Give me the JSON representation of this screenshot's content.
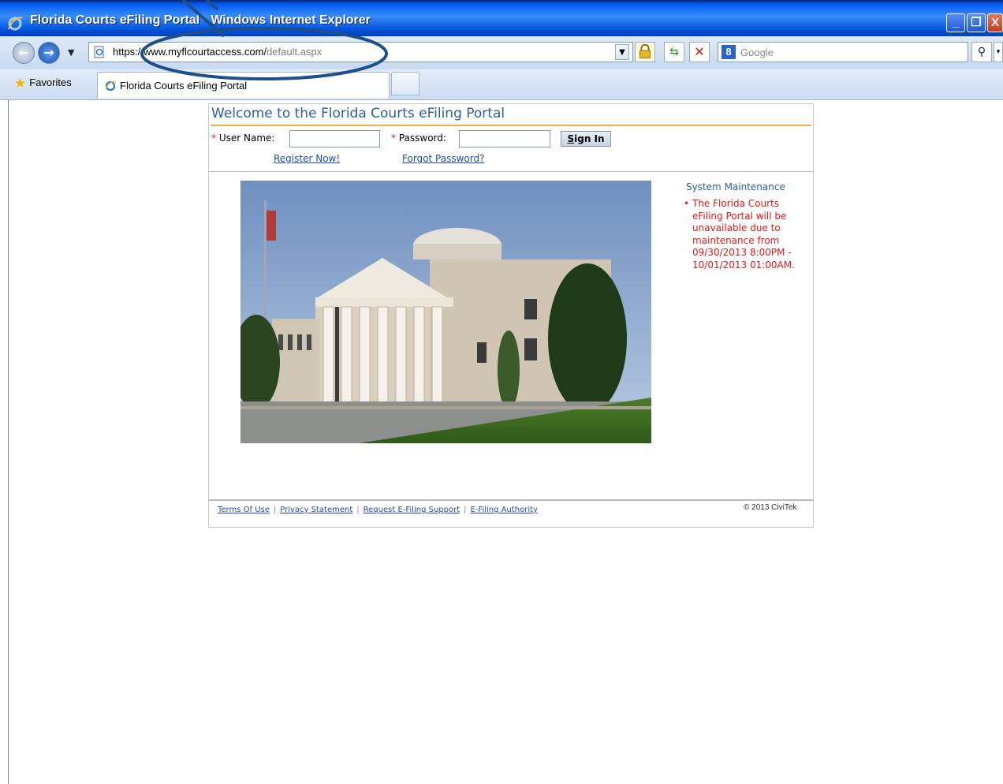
{
  "window": {
    "title": "Florida Courts eFiling Portal - Windows Internet Explorer",
    "controls": {
      "minimize": "_",
      "maximize": "❐",
      "close": "X"
    }
  },
  "toolbar": {
    "url_host": "https://www.myflcourtaccess.com/",
    "url_path": "default.aspx",
    "search_provider": "Google",
    "search_icon_letter": "8",
    "favorites_label": "Favorites"
  },
  "tabs": [
    {
      "label": "Florida Courts eFiling Portal",
      "active": true
    }
  ],
  "portal": {
    "welcome": "Welcome to the Florida Courts eFiling Portal",
    "required_marker": "*",
    "username_label": "User Name:",
    "password_label": "Password:",
    "username_value": "",
    "password_value": "",
    "signin_first": "S",
    "signin_rest": "ign In",
    "register_link": "Register Now!",
    "forgot_link": "Forgot Password?"
  },
  "maintenance": {
    "title": "System Maintenance",
    "bullet": "•",
    "message": "The Florida Courts eFiling Portal will be unavailable due to maintenance from 09/30/2013 8:00PM - 10/01/2013 01:00AM."
  },
  "footer": {
    "links": [
      "Terms Of Use",
      "Privacy Statement",
      "Request E-Filing Support",
      "E-Filing Authority"
    ],
    "separator": "|",
    "copyright": "© 2013 CiviTek"
  },
  "colors": {
    "title_blue": "#2a5ea5",
    "accent_rule": "#f0b040",
    "alert_red": "#e01818",
    "link_blue": "#1f4ea8",
    "annotation_oval": "#1f4e8c"
  },
  "icons": [
    "ie-logo-icon",
    "back-arrow-icon",
    "forward-arrow-icon",
    "page-icon",
    "lock-icon",
    "refresh-icon",
    "stop-icon",
    "google-icon",
    "search-icon",
    "favorites-star-icon",
    "courthouse-photo"
  ]
}
